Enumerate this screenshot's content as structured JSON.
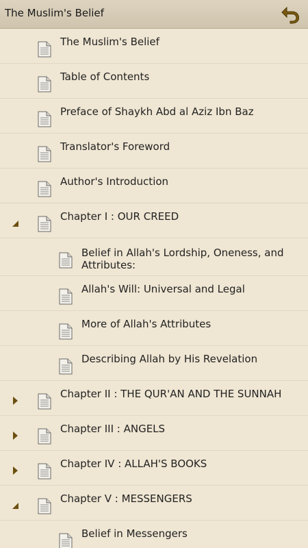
{
  "header": {
    "title": "The Muslim's Belief",
    "back_icon": "back-arrow-icon"
  },
  "colors": {
    "background": "#efe6d3",
    "header": "#d6ccb6",
    "accent": "#7a5a10"
  },
  "items": [
    {
      "label": "The Muslim's Belief",
      "level": 0,
      "expander": "none"
    },
    {
      "label": "Table of Contents",
      "level": 0,
      "expander": "none"
    },
    {
      "label": "Preface of Shaykh Abd al Aziz Ibn Baz",
      "level": 0,
      "expander": "none"
    },
    {
      "label": "Translator's Foreword",
      "level": 0,
      "expander": "none"
    },
    {
      "label": "Author's Introduction",
      "level": 0,
      "expander": "none"
    },
    {
      "label": "Chapter I : OUR CREED",
      "level": 0,
      "expander": "expanded"
    },
    {
      "label": "Belief in Allah's Lordship, Oneness, and Attributes:",
      "level": 1,
      "expander": "none"
    },
    {
      "label": "Allah's Will: Universal and Legal",
      "level": 1,
      "expander": "none"
    },
    {
      "label": "More of Allah's Attributes",
      "level": 1,
      "expander": "none"
    },
    {
      "label": "Describing Allah by His Revelation",
      "level": 1,
      "expander": "none"
    },
    {
      "label": "Chapter II : THE QUR'AN AND THE SUNNAH",
      "level": 0,
      "expander": "collapsed"
    },
    {
      "label": "Chapter III : ANGELS",
      "level": 0,
      "expander": "collapsed"
    },
    {
      "label": "Chapter IV : ALLAH'S BOOKS",
      "level": 0,
      "expander": "collapsed"
    },
    {
      "label": "Chapter V : MESSENGERS",
      "level": 0,
      "expander": "expanded"
    },
    {
      "label": "Belief in Messengers",
      "level": 1,
      "expander": "none"
    }
  ]
}
